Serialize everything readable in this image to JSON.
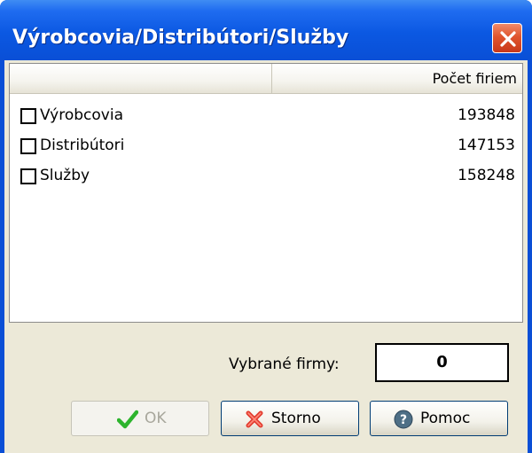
{
  "window": {
    "title": "Výrobcovia/Distribútori/Služby"
  },
  "list": {
    "column_header": "Počet firiem",
    "rows": [
      {
        "label": "Výrobcovia",
        "count": "193848",
        "checked": false
      },
      {
        "label": "Distribútori",
        "count": "147153",
        "checked": false
      },
      {
        "label": "Služby",
        "count": "158248",
        "checked": false
      }
    ]
  },
  "selection": {
    "label": "Vybrané firmy:",
    "value": "0"
  },
  "buttons": {
    "ok": {
      "label": "OK",
      "icon": "checkmark-icon",
      "enabled": false
    },
    "storno": {
      "label": "Storno",
      "icon": "red-x-icon"
    },
    "pomoc": {
      "label": "Pomoc",
      "icon": "help-icon"
    }
  },
  "colors": {
    "titlebar": "#0a4fd6",
    "close": "#e0552e",
    "panel": "#ece9d8"
  }
}
